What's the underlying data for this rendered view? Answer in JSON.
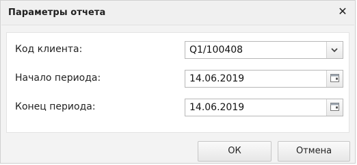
{
  "dialog": {
    "title": "Параметры отчета",
    "close_icon": "close-icon"
  },
  "fields": [
    {
      "label": "Код клиента:",
      "value": "Q1/100408",
      "trigger": "chevron-down-icon"
    },
    {
      "label": "Начало периода:",
      "value": "14.06.2019",
      "trigger": "calendar-icon"
    },
    {
      "label": "Конец периода:",
      "value": "14.06.2019",
      "trigger": "calendar-icon"
    }
  ],
  "buttons": {
    "ok": "ОК",
    "cancel": "Отмена"
  }
}
